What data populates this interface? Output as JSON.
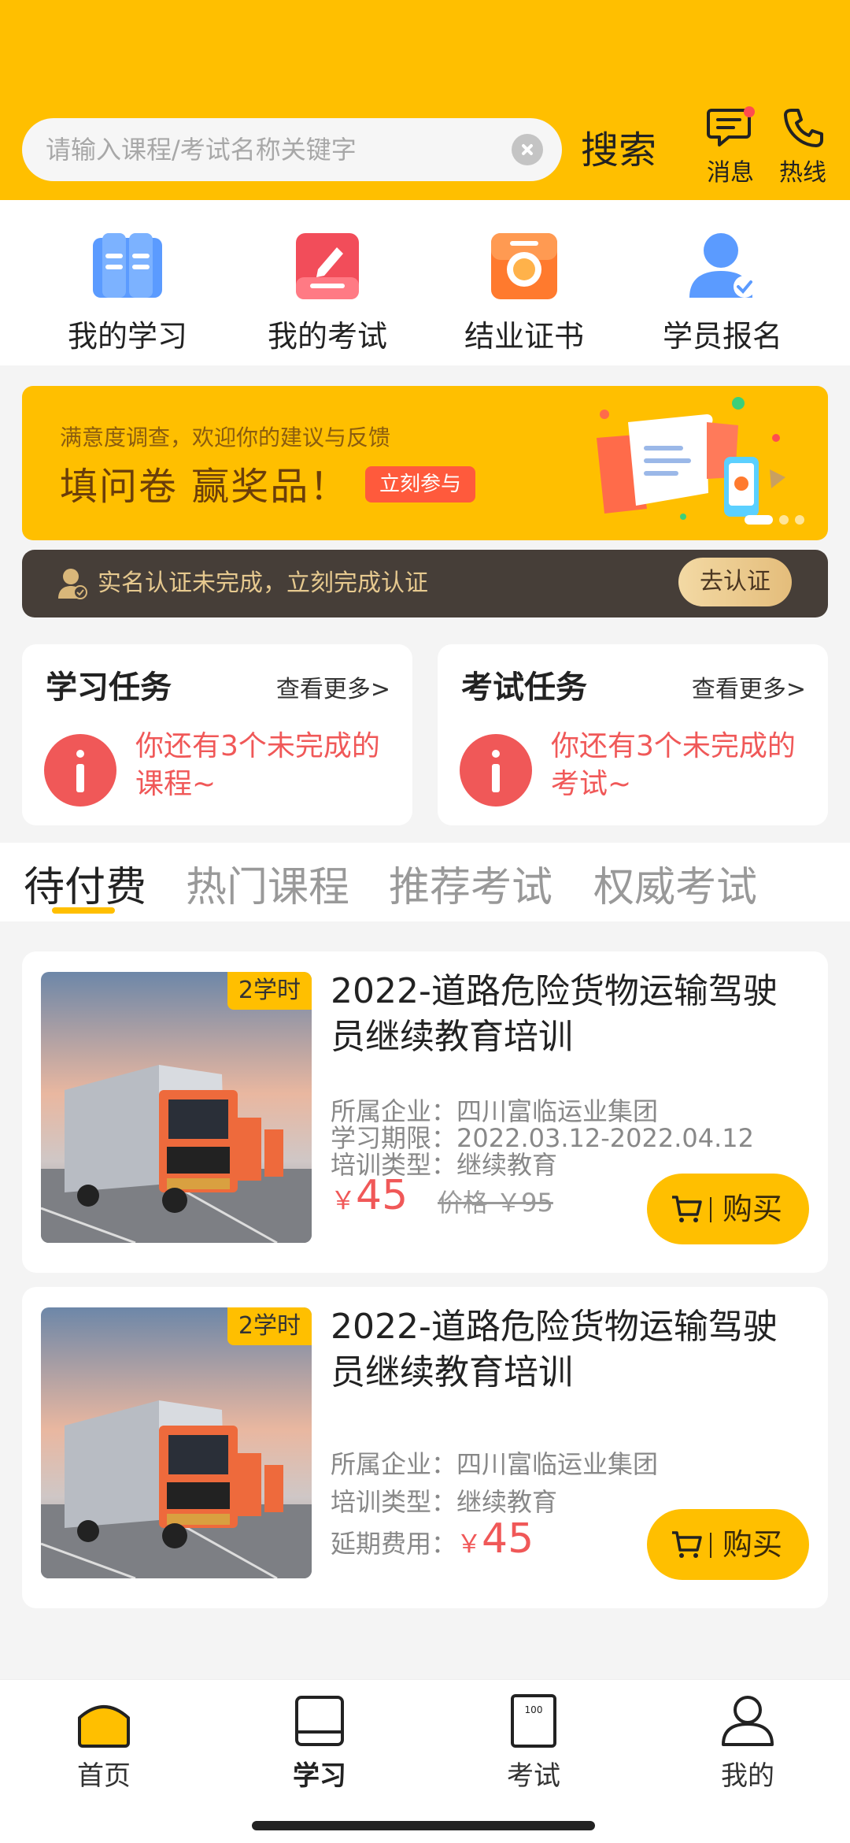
{
  "header": {
    "search_placeholder": "请输入课程/考试名称关键字",
    "search_button": "搜索",
    "messages_label": "消息",
    "hotline_label": "热线",
    "bg_color": "#ffbf00"
  },
  "quick_entries": [
    {
      "label": "我的学习",
      "icon": "book-icon"
    },
    {
      "label": "我的考试",
      "icon": "exam-edit-icon"
    },
    {
      "label": "结业证书",
      "icon": "certificate-icon"
    },
    {
      "label": "学员报名",
      "icon": "student-signup-icon"
    }
  ],
  "banner": {
    "subtitle": "满意度调查，欢迎你的建议与反馈",
    "headline": "填问卷  赢奖品！",
    "cta": "立刻参与"
  },
  "verify_bar": {
    "text": "实名认证未完成，立刻完成认证",
    "button": "去认证"
  },
  "tasks": {
    "study": {
      "title": "学习任务",
      "more": "查看更多>",
      "message": "你还有3个未完成的课程~"
    },
    "exam": {
      "title": "考试任务",
      "more": "查看更多>",
      "message": "你还有3个未完成的考试~"
    }
  },
  "tabs": [
    {
      "label": "待付费",
      "active": true
    },
    {
      "label": "热门课程",
      "active": false
    },
    {
      "label": "推荐考试",
      "active": false
    },
    {
      "label": "权威考试",
      "active": false
    }
  ],
  "courses": [
    {
      "hours": "2学时",
      "title": "2022-道路危险货物运输驾驶员继续教育培训",
      "company_label": "所属企业：",
      "company": "四川富临运业集团",
      "period_label": "学习期限：",
      "period": "2022.03.12-2022.04.12",
      "type_label": "培训类型：",
      "type": "继续教育",
      "price_symbol": "￥",
      "price": "45",
      "original_price": "价格 ￥95",
      "buy_label": "购买"
    },
    {
      "hours": "2学时",
      "title": "2022-道路危险货物运输驾驶员继续教育培训",
      "company_label": "所属企业：",
      "company": "四川富临运业集团",
      "type_label": "培训类型：",
      "type": "继续教育",
      "extension_label": "延期费用：",
      "price_symbol": "￥",
      "price": "45",
      "buy_label": "购买"
    }
  ],
  "bottom_nav": [
    {
      "label": "首页",
      "icon": "home-icon"
    },
    {
      "label": "学习",
      "icon": "study-book-icon",
      "active": true
    },
    {
      "label": "考试",
      "icon": "exam-paper-icon"
    },
    {
      "label": "我的",
      "icon": "user-icon"
    }
  ]
}
